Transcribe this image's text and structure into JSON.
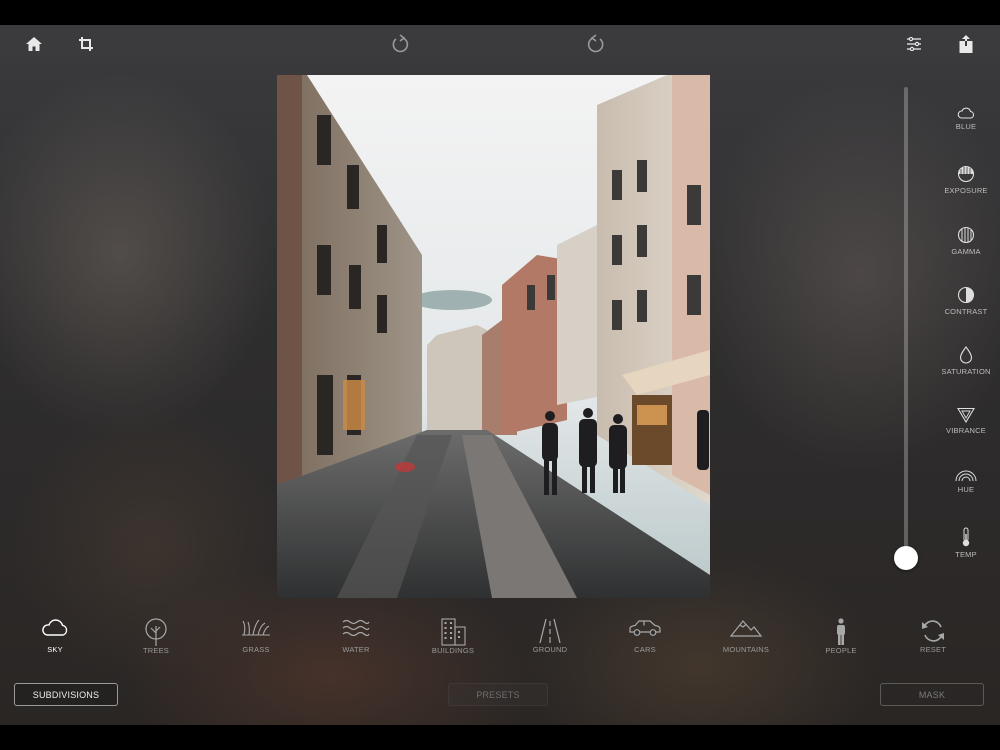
{
  "topbar": {
    "icons": [
      "home-icon",
      "crop-icon",
      "undo-icon",
      "redo-icon",
      "sliders-icon",
      "share-icon"
    ]
  },
  "adjustments": [
    {
      "label": "BLUE",
      "icon": "cloud-icon"
    },
    {
      "label": "EXPOSURE",
      "icon": "exposure-icon"
    },
    {
      "label": "GAMMA",
      "icon": "gamma-icon"
    },
    {
      "label": "CONTRAST",
      "icon": "contrast-icon"
    },
    {
      "label": "SATURATION",
      "icon": "droplet-icon"
    },
    {
      "label": "VIBRANCE",
      "icon": "vibrance-icon"
    },
    {
      "label": "HUE",
      "icon": "rainbow-icon"
    },
    {
      "label": "TEMP",
      "icon": "thermometer-icon"
    }
  ],
  "segments": [
    {
      "label": "SKY",
      "icon": "cloud-icon",
      "active": true
    },
    {
      "label": "TREES",
      "icon": "tree-icon"
    },
    {
      "label": "GRASS",
      "icon": "grass-icon"
    },
    {
      "label": "WATER",
      "icon": "waves-icon"
    },
    {
      "label": "BUILDINGS",
      "icon": "building-icon"
    },
    {
      "label": "GROUND",
      "icon": "road-icon"
    },
    {
      "label": "CARS",
      "icon": "car-icon"
    },
    {
      "label": "MOUNTAINS",
      "icon": "mountain-icon"
    },
    {
      "label": "PEOPLE",
      "icon": "person-icon"
    },
    {
      "label": "RESET",
      "icon": "reset-icon"
    }
  ],
  "buttons": {
    "subdivisions": "SUBDIVISIONS",
    "presets": "PRESETS",
    "mask": "MASK"
  },
  "colors": {
    "accent": "#ffffff",
    "inactive_label": "#9a9a9a"
  }
}
